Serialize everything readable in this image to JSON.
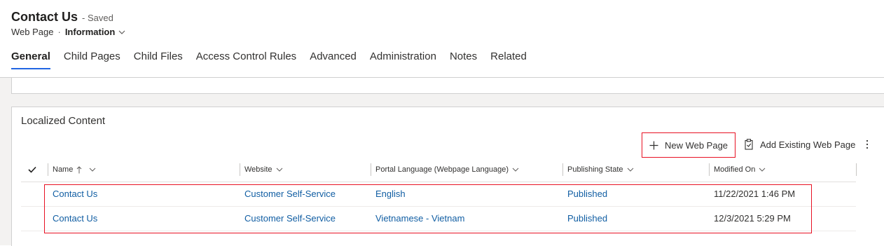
{
  "header": {
    "title": "Contact Us",
    "saved_status": "- Saved",
    "entity_name": "Web Page",
    "separator": "·",
    "form_name": "Information"
  },
  "tabs": [
    {
      "label": "General",
      "active": true
    },
    {
      "label": "Child Pages",
      "active": false
    },
    {
      "label": "Child Files",
      "active": false
    },
    {
      "label": "Access Control Rules",
      "active": false
    },
    {
      "label": "Advanced",
      "active": false
    },
    {
      "label": "Administration",
      "active": false
    },
    {
      "label": "Notes",
      "active": false
    },
    {
      "label": "Related",
      "active": false
    }
  ],
  "section": {
    "title": "Localized Content",
    "commands": {
      "new_label": "New Web Page",
      "add_existing_label": "Add Existing Web Page",
      "more_icon": "more-vertical-icon"
    }
  },
  "grid": {
    "columns": [
      {
        "label": "Name",
        "sorted": "ascending"
      },
      {
        "label": "Website"
      },
      {
        "label": "Portal Language (Webpage Language)"
      },
      {
        "label": "Publishing State"
      },
      {
        "label": "Modified On"
      }
    ],
    "rows": [
      {
        "name": "Contact Us",
        "website": "Customer Self-Service",
        "language": "English",
        "state": "Published",
        "modified": "11/22/2021 1:46 PM"
      },
      {
        "name": "Contact Us",
        "website": "Customer Self-Service",
        "language": "Vietnamese - Vietnam",
        "state": "Published",
        "modified": "12/3/2021 5:29 PM"
      }
    ]
  },
  "colors": {
    "accent": "#2266e3",
    "link": "#115ea3",
    "highlight": "#e81123"
  }
}
